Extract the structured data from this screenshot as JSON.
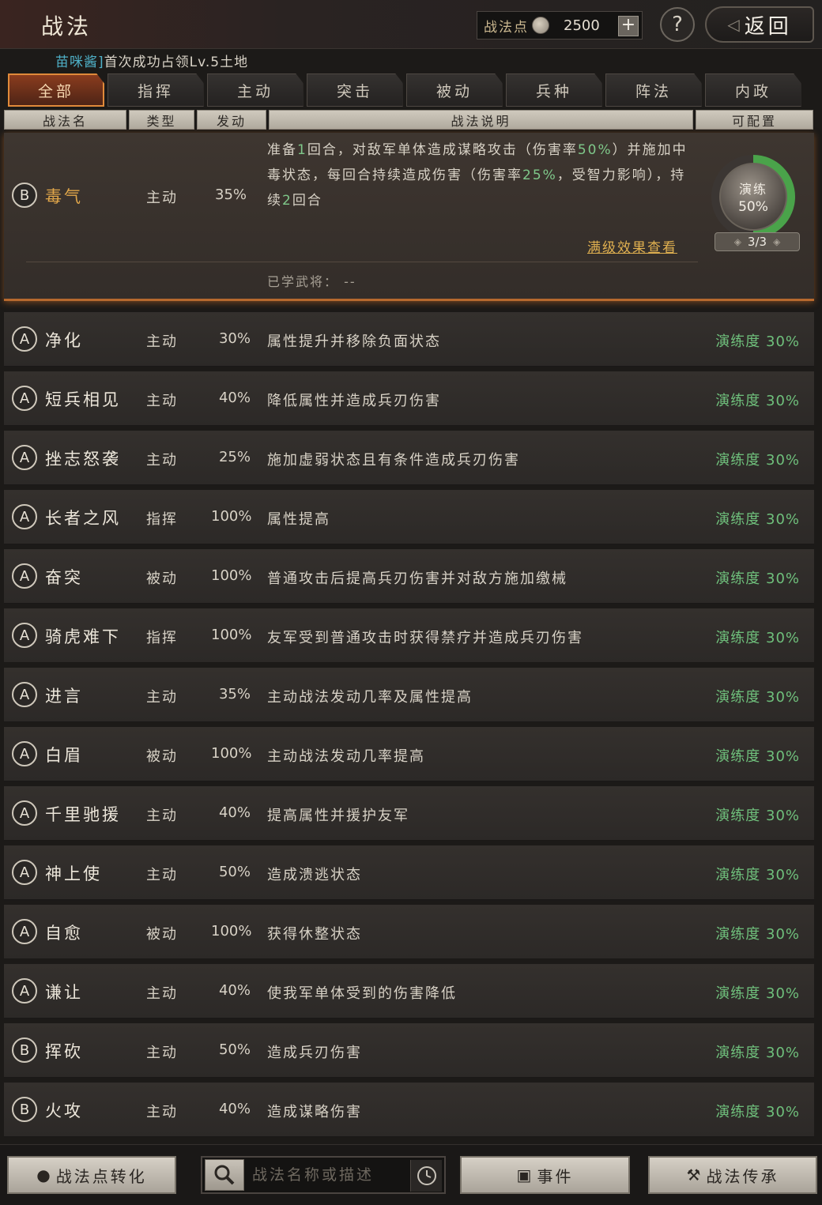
{
  "header": {
    "title": "战法",
    "points_label": "战法点",
    "points_value": "2500",
    "plus": "+",
    "help": "?",
    "back_label": "返回"
  },
  "notice": {
    "name": "苗咪酱]",
    "text": "首次成功占领Lv.5土地"
  },
  "tabs": [
    {
      "label": "全部",
      "active": true
    },
    {
      "label": "指挥",
      "active": false
    },
    {
      "label": "主动",
      "active": false
    },
    {
      "label": "突击",
      "active": false
    },
    {
      "label": "被动",
      "active": false
    },
    {
      "label": "兵种",
      "active": false
    },
    {
      "label": "阵法",
      "active": false
    },
    {
      "label": "内政",
      "active": false
    }
  ],
  "columns": {
    "name": "战法名",
    "type": "类型",
    "rate": "发动",
    "desc": "战法说明",
    "config": "可配置"
  },
  "expanded": {
    "grade": "B",
    "name": "毒气",
    "type": "主动",
    "rate": "35%",
    "desc_1": "准备",
    "desc_n1": "1",
    "desc_2": "回合，对敌军单体造成谋略攻击（伤害率",
    "desc_n2": "50%",
    "desc_3": "）并施加中毒状态，每回合持续造成伤害（伤害率",
    "desc_n3": "25%",
    "desc_4": "，受智力影响），持续",
    "desc_n4": "2",
    "desc_5": "回合",
    "full_link": "满级效果查看",
    "learned_label": "已学武将：",
    "learned_value": "--",
    "practice_label": "演练",
    "practice_pct": "50%",
    "practice_fraction": 0.5,
    "practice_count": "3/3"
  },
  "rows": [
    {
      "grade": "A",
      "name": "净化",
      "type": "主动",
      "rate": "30%",
      "desc": "属性提升并移除负面状态",
      "practice": "演练度 30%"
    },
    {
      "grade": "A",
      "name": "短兵相见",
      "type": "主动",
      "rate": "40%",
      "desc": "降低属性并造成兵刃伤害",
      "practice": "演练度 30%"
    },
    {
      "grade": "A",
      "name": "挫志怒袭",
      "type": "主动",
      "rate": "25%",
      "desc": "施加虚弱状态且有条件造成兵刃伤害",
      "practice": "演练度 30%"
    },
    {
      "grade": "A",
      "name": "长者之风",
      "type": "指挥",
      "rate": "100%",
      "desc": "属性提高",
      "practice": "演练度 30%"
    },
    {
      "grade": "A",
      "name": "奋突",
      "type": "被动",
      "rate": "100%",
      "desc": "普通攻击后提高兵刃伤害并对敌方施加缴械",
      "practice": "演练度 30%"
    },
    {
      "grade": "A",
      "name": "骑虎难下",
      "type": "指挥",
      "rate": "100%",
      "desc": "友军受到普通攻击时获得禁疗并造成兵刃伤害",
      "practice": "演练度 30%"
    },
    {
      "grade": "A",
      "name": "进言",
      "type": "主动",
      "rate": "35%",
      "desc": "主动战法发动几率及属性提高",
      "practice": "演练度 30%"
    },
    {
      "grade": "A",
      "name": "白眉",
      "type": "被动",
      "rate": "100%",
      "desc": "主动战法发动几率提高",
      "practice": "演练度 30%"
    },
    {
      "grade": "A",
      "name": "千里驰援",
      "type": "主动",
      "rate": "40%",
      "desc": "提高属性并援护友军",
      "practice": "演练度 30%"
    },
    {
      "grade": "A",
      "name": "神上使",
      "type": "主动",
      "rate": "50%",
      "desc": "造成溃逃状态",
      "practice": "演练度 30%"
    },
    {
      "grade": "A",
      "name": "自愈",
      "type": "被动",
      "rate": "100%",
      "desc": "获得休整状态",
      "practice": "演练度 30%"
    },
    {
      "grade": "A",
      "name": "谦让",
      "type": "主动",
      "rate": "40%",
      "desc": "使我军单体受到的伤害降低",
      "practice": "演练度 30%"
    },
    {
      "grade": "B",
      "name": "挥砍",
      "type": "主动",
      "rate": "50%",
      "desc": "造成兵刃伤害",
      "practice": "演练度 30%"
    },
    {
      "grade": "B",
      "name": "火攻",
      "type": "主动",
      "rate": "40%",
      "desc": "造成谋略伤害",
      "practice": "演练度 30%"
    }
  ],
  "bottom": {
    "convert_label": "战法点转化",
    "search_placeholder": "战法名称或描述",
    "events_label": "事件",
    "inherit_label": "战法传承"
  }
}
